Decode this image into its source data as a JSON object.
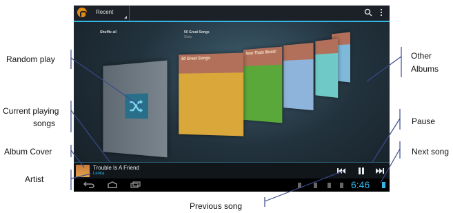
{
  "screen": {
    "view_label": "Recent",
    "albums": [
      {
        "title": "Shuffle all",
        "subtitle": ""
      },
      {
        "title": "50 Great Songs",
        "subtitle": "Slots",
        "cover_text": "50 Great Songs"
      },
      {
        "title": "",
        "subtitle": "",
        "cover_text": "Now Thats Music"
      },
      {
        "title": "",
        "subtitle": "",
        "cover_text": ""
      },
      {
        "title": "",
        "subtitle": "",
        "cover_text": ""
      },
      {
        "title": "",
        "subtitle": "",
        "cover_text": ""
      }
    ],
    "now_playing": {
      "title": "Trouble Is A Friend",
      "artist": "Lenka"
    },
    "clock": "6:46",
    "accent_color": "#33b5e5",
    "icons": [
      "headphones-icon",
      "search-icon",
      "overflow-menu-icon",
      "shuffle-icon",
      "previous-icon",
      "pause-icon",
      "next-icon",
      "back-icon",
      "home-icon",
      "recent-apps-icon",
      "battery-icon"
    ]
  },
  "callouts": {
    "random_play": "Random play",
    "current_playing_line1": "Current playing",
    "current_playing_line2": "songs",
    "album_cover": "Album Cover",
    "artist": "Artist",
    "other_albums_line1": "Other",
    "other_albums_line2": "Albums",
    "pause": "Pause",
    "next_song": "Next song",
    "previous_song": "Previous song"
  }
}
